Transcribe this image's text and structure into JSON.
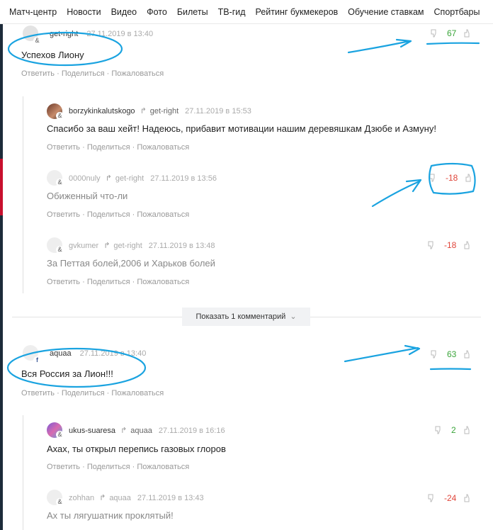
{
  "nav": {
    "items": [
      "Матч-центр",
      "Новости",
      "Видео",
      "Фото",
      "Билеты",
      "ТВ-гид",
      "Рейтинг букмекеров",
      "Обучение ставкам",
      "Спортбары"
    ]
  },
  "actions": {
    "reply": "Ответить",
    "share": "Поделиться",
    "report": "Пожаловаться",
    "sep": " · "
  },
  "comments": [
    {
      "author": "get-right",
      "reply_to": "",
      "date": "27.11.2019 в 13:40",
      "text": "Успехов Лиону",
      "score": "67",
      "badge": "&"
    },
    {
      "author": "borzykinkalutskogo",
      "reply_to": "get-right",
      "date": "27.11.2019 в 15:53",
      "text": "Спасибо за ваш хейт! Надеюсь, прибавит мотивации нашим деревяшкам Дзюбе и Азмуну!",
      "score": "",
      "badge": "&"
    },
    {
      "author": "0000nuly",
      "reply_to": "get-right",
      "date": "27.11.2019 в 13:56",
      "text": "Обиженный что-ли",
      "score": "-18",
      "badge": "&"
    },
    {
      "author": "gvkumer",
      "reply_to": "get-right",
      "date": "27.11.2019 в 13:48",
      "text": "За Петтая болей,2006 и Харьков болей",
      "score": "-18",
      "badge": "&"
    },
    {
      "author": "aquaa",
      "reply_to": "",
      "date": "27.11.2019 в 13:40",
      "text": "Вся Россия за Лион!!!",
      "score": "63",
      "badge": "f"
    },
    {
      "author": "ukus-suaresa",
      "reply_to": "aquaa",
      "date": "27.11.2019 в 16:16",
      "text": "Ахах, ты открыл перепись газовых глоров",
      "score": "2",
      "badge": "&"
    },
    {
      "author": "zohhan",
      "reply_to": "aquaa",
      "date": "27.11.2019 в 13:43",
      "text": "Ах ты лягушатник проклятый!",
      "score": "-24",
      "badge": "&"
    }
  ],
  "show_more": "Показать 1 комментарий",
  "colors": {
    "positive": "#3aa53a",
    "negative": "#e0453a",
    "annotation": "#1aa3e0",
    "meta": "#aaaaaa"
  },
  "icons": [
    "thumb-down-icon",
    "thumb-up-icon",
    "reply-arrow-icon",
    "chevron-down-icon"
  ]
}
